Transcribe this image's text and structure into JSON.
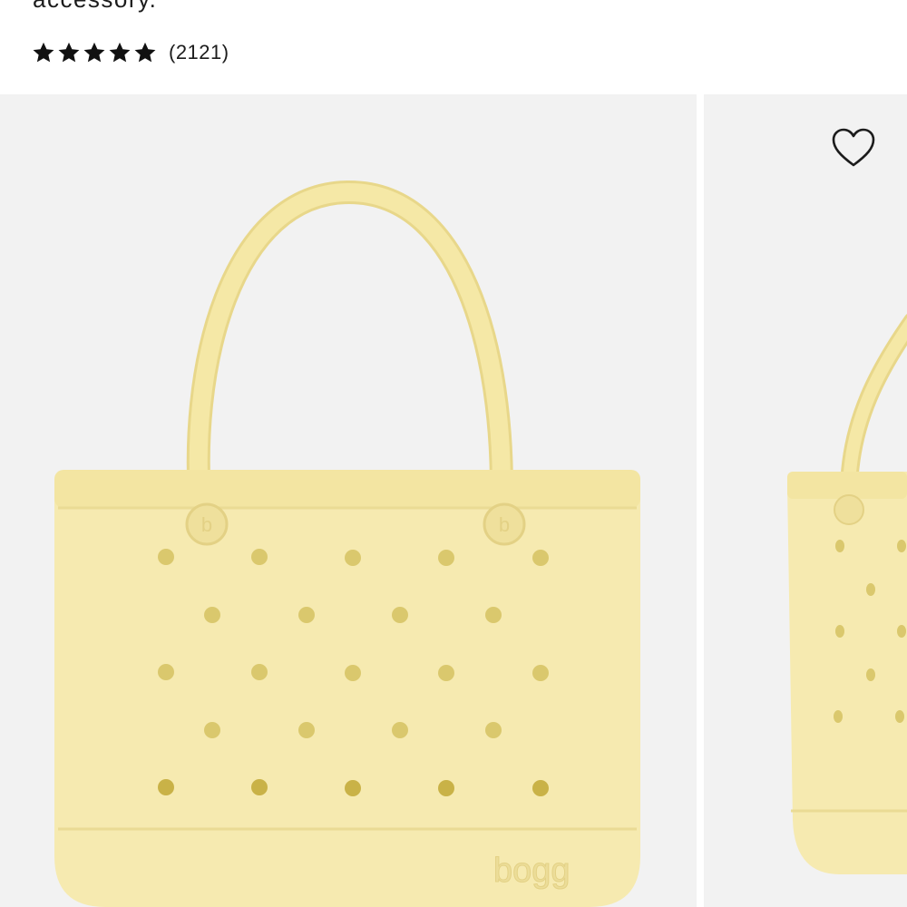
{
  "product": {
    "description_tail": "accessory.",
    "rating": {
      "stars": 5,
      "max_stars": 5,
      "review_count": "(2121)"
    }
  },
  "gallery": {
    "main_image": {
      "subject": "bogg bag tote",
      "color": "#f5e8a6",
      "brand_mark": "bogg"
    },
    "next_image": {
      "subject": "bogg bag tote side view"
    },
    "wishlist_icon": "heart-outline-icon"
  },
  "colors": {
    "background": "#f2f2f2",
    "bag": "#f5e8a6",
    "bag_shadow": "#e8d78a",
    "hole": "#d6c46a",
    "text": "#1c1c1c"
  }
}
